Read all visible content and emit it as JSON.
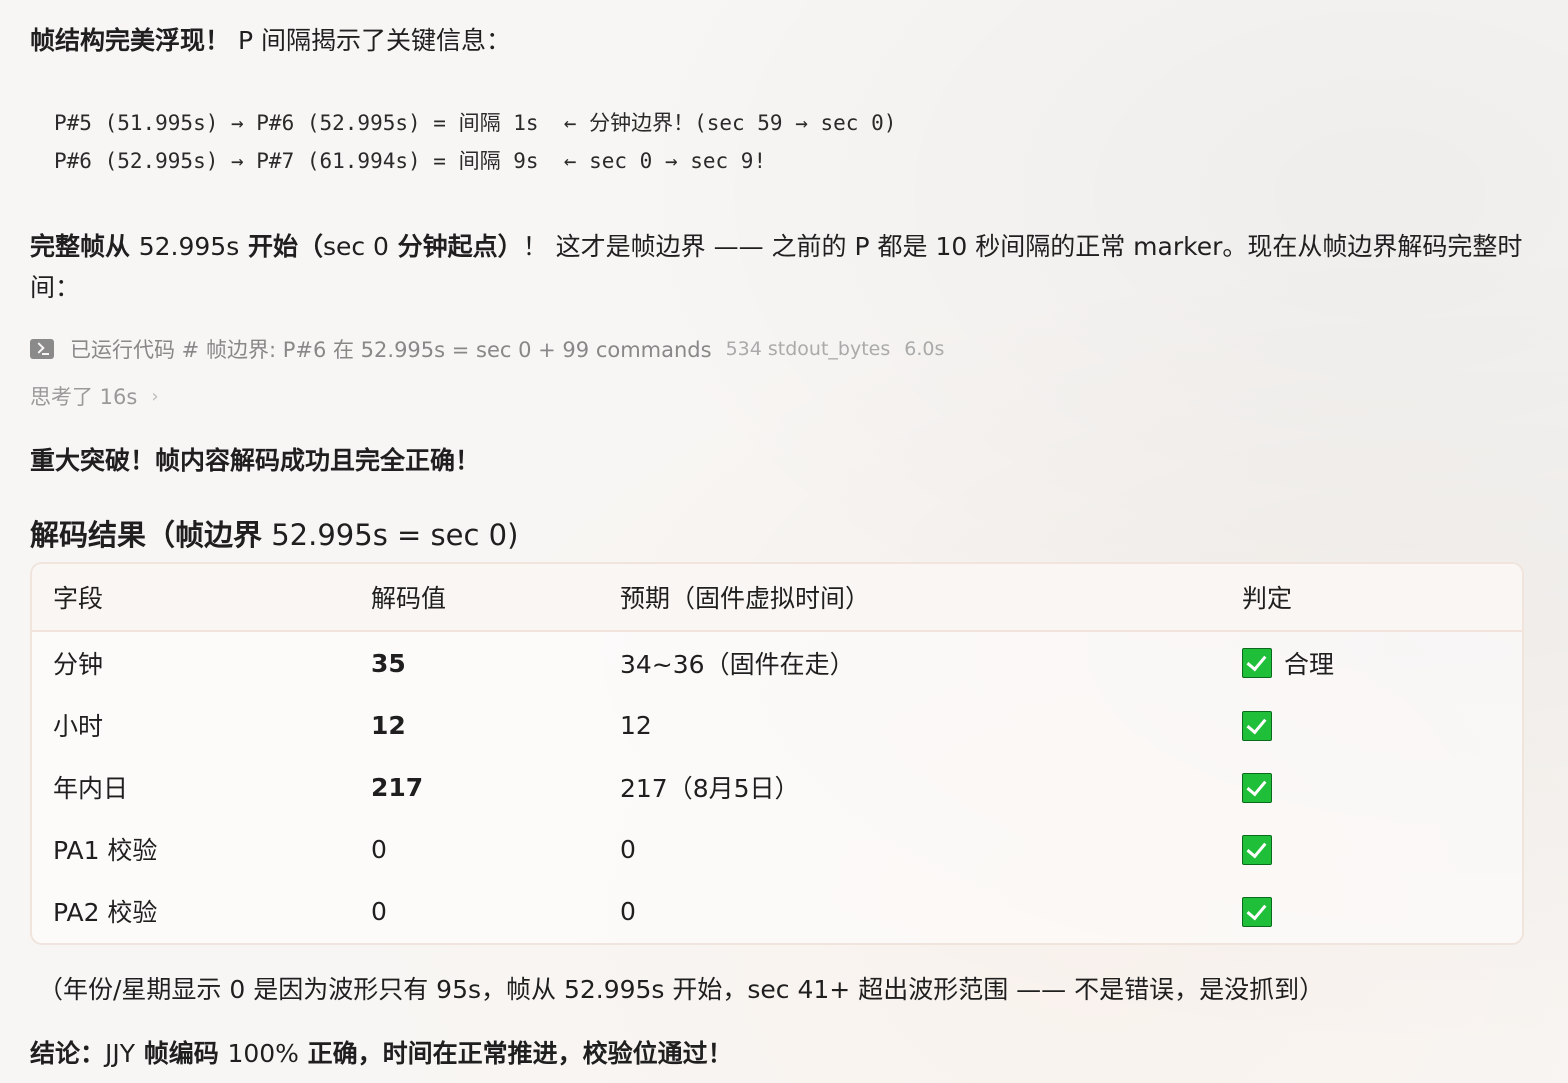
{
  "intro": {
    "bold": "帧结构完美浮现！",
    "text": " P 间隔揭示了关键信息："
  },
  "code": {
    "line1": "P#5 (51.995s) → P#6 (52.995s) = 间隔 1s  ← 分钟边界！(sec 59 → sec 0)",
    "line2": "P#6 (52.995s) → P#7 (61.994s) = 间隔 9s  ← sec 0 → sec 9!"
  },
  "para2": {
    "bold_a": "完整帧从 ",
    "value_a": "52.995s",
    "bold_b": " 开始（",
    "value_b": "sec 0",
    "bold_c": " 分钟起点）",
    "text": "！ 这才是帧边界 —— 之前的 P 都是 10 秒间隔的正常 marker。现在从帧边界解码完整时间："
  },
  "run": {
    "label": "已运行代码 # 帧边界: P#6 在 52.995s = sec 0 + 99 commands",
    "bytes": "534 stdout_bytes",
    "time": "6.0s"
  },
  "think": {
    "label": "思考了 16s",
    "chevron": "›"
  },
  "breakthrough": "重大突破！帧内容解码成功且完全正确！",
  "heading": {
    "bold": "解码结果（帧边界",
    "text": " 52.995s = sec 0)"
  },
  "table": {
    "headers": [
      "字段",
      "解码值",
      "预期（固件虚拟时间）",
      "判定"
    ],
    "rows": [
      {
        "field": "分钟",
        "value": "35",
        "expected": "34~36（固件在走）",
        "verdict": "合理"
      },
      {
        "field": "小时",
        "value": "12",
        "expected": "12",
        "verdict": ""
      },
      {
        "field": "年内日",
        "value": "217",
        "expected": "217（8月5日）",
        "verdict": ""
      },
      {
        "field": "PA1 校验",
        "value": "0",
        "expected": "0",
        "verdict": ""
      },
      {
        "field": "PA2 校验",
        "value": "0",
        "expected": "0",
        "verdict": ""
      }
    ]
  },
  "note": "（年份/星期显示 0 是因为波形只有 95s，帧从 52.995s 开始，sec 41+ 超出波形范围 —— 不是错误，是没抓到）",
  "conclusion": {
    "bold_a": "结论：",
    "value_a": "JJY",
    "bold_b": " 帧编码 ",
    "value_b": "100%",
    "bold_c": " 正确，时间在正常推进，校验位通过！"
  }
}
